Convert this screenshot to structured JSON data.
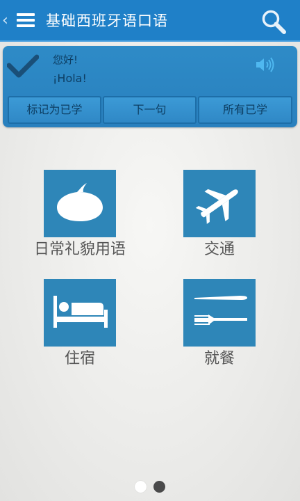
{
  "header": {
    "title": "基础西班牙语口语",
    "back_glyph": "‹",
    "menu_icon": "hamburger-menu-icon",
    "search_icon": "search-icon",
    "background_color": "#1f80c8"
  },
  "phrase_card": {
    "chinese": "您好!",
    "spanish": "¡Hola!",
    "check_icon": "checkmark-icon",
    "audio_icon": "speaker-icon",
    "buttons": [
      {
        "label": "标记为已学"
      },
      {
        "label": "下一句"
      },
      {
        "label": "所有已学"
      }
    ]
  },
  "categories": [
    {
      "label": "日常礼貌用语",
      "icon": "speech-bubble-icon"
    },
    {
      "label": "交通",
      "icon": "airplane-icon"
    },
    {
      "label": "住宿",
      "icon": "bed-icon"
    },
    {
      "label": "就餐",
      "icon": "knife-fork-icon"
    }
  ],
  "pager": {
    "page_count": 2,
    "active_page": 2
  },
  "colors": {
    "accent": "#1f80c8",
    "tile": "#2e86b8",
    "card_text": "#0d3e63",
    "label_text": "#555555"
  }
}
